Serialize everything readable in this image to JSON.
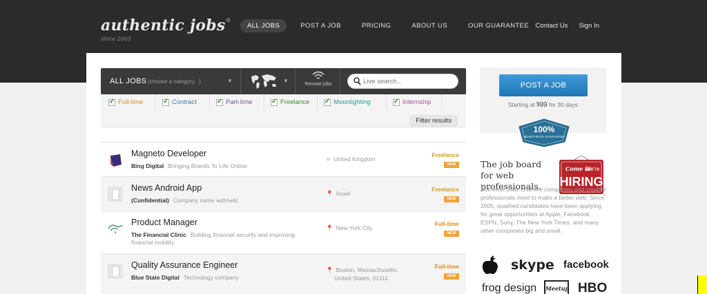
{
  "header": {
    "logo": "authentic jobs",
    "tagline": "since 2005",
    "nav": [
      "ALL JOBS",
      "POST A JOB",
      "PRICING",
      "ABOUT US",
      "OUR GUARANTEE"
    ],
    "account": [
      "Contact Us",
      "Sign In"
    ]
  },
  "filterbar": {
    "label": "ALL JOBS",
    "category_placeholder": "(choose a category...)",
    "remote_label": "Remote jobs",
    "search_placeholder": "Live search..."
  },
  "types": [
    {
      "label": "Full-time",
      "color": "#e08a1e"
    },
    {
      "label": "Contract",
      "color": "#3a7fa8"
    },
    {
      "label": "Part-time",
      "color": "#7a4fa8"
    },
    {
      "label": "Freelance",
      "color": "#3a8a2c"
    },
    {
      "label": "Moonlighting",
      "color": "#2a9a8a"
    },
    {
      "label": "Internship",
      "color": "#b04fa8"
    }
  ],
  "filter_button": "Filter results",
  "jobs": [
    {
      "title": "Magneto Developer",
      "company": "Bing Digital",
      "desc": "Bringing Brands To Life Online",
      "location": "United Kingdom",
      "loc_icon": "wifi-icon",
      "type": "Freelance",
      "type_color": "#d8971e",
      "badge": "NEW"
    },
    {
      "title": "News Android App",
      "company": "(Confidential)",
      "desc": "Company name withheld",
      "location": "Israel",
      "loc_icon": "pin-icon",
      "type": "Freelance",
      "type_color": "#d8971e",
      "badge": "NEW"
    },
    {
      "title": "Product Manager",
      "company": "The Financial Clinic",
      "desc": "Building financial security and improving",
      "desc2": "financial mobility",
      "location": "New York City",
      "loc_icon": "pin-icon",
      "type": "Full-time",
      "type_color": "#e08a1e",
      "badge": "NEW"
    },
    {
      "title": "Quality Assurance Engineer",
      "company": "Blue State Digital",
      "desc": "Technology company",
      "location": "Boston, Massachusetts,",
      "location2": "United States, 02111",
      "loc_icon": "pin-icon",
      "type": "Full-time",
      "type_color": "#e08a1e",
      "badge": "NEW"
    }
  ],
  "sidebar": {
    "post_button": "POST A JOB",
    "starting_prefix": "Starting at",
    "price_symbol": "$",
    "price": "99",
    "starting_suffix": "for 30 days",
    "guarantee_big": "100%",
    "guarantee_small": "MONEY-BACK GUARANTEE",
    "board_title": "The job board for web professionals.",
    "hiring_top": "Come in",
    "hiring_were": "We're",
    "hiring_big": "HIRING",
    "about": "Authentic Jobs is where companies and creative professionals meet to make a better web. Since 2005, qualified candidates have been applying for great opportunities at Apple, Facebook, ESPN, Sony, The New York Times, and many other companies big and small.",
    "brands": [
      "skype",
      "facebook",
      "frog design",
      "Meetup",
      "HBO"
    ]
  }
}
